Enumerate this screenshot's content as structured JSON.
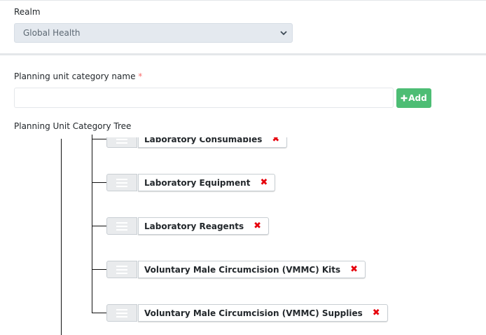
{
  "realm": {
    "label": "Realm",
    "selected": "Global Health"
  },
  "form": {
    "category_label": "Planning unit category name",
    "required_mark": "*",
    "category_value": "",
    "add_label": "Add",
    "add_icon": "plus-icon"
  },
  "tree": {
    "label": "Planning Unit Category Tree",
    "nodes": [
      {
        "label": "Laboratory Consumables",
        "remove": "✖"
      },
      {
        "label": "Laboratory Equipment",
        "remove": "✖"
      },
      {
        "label": "Laboratory Reagents",
        "remove": "✖"
      },
      {
        "label": "Voluntary Male Circumcision (VMMC) Kits",
        "remove": "✖"
      },
      {
        "label": "Voluntary Male Circumcision (VMMC) Supplies",
        "remove": "✖"
      }
    ]
  },
  "colors": {
    "add_button": "#4dbd74",
    "remove_icon": "#e6000c",
    "required": "#f86c6b",
    "select_bg": "#e4e9ef"
  }
}
